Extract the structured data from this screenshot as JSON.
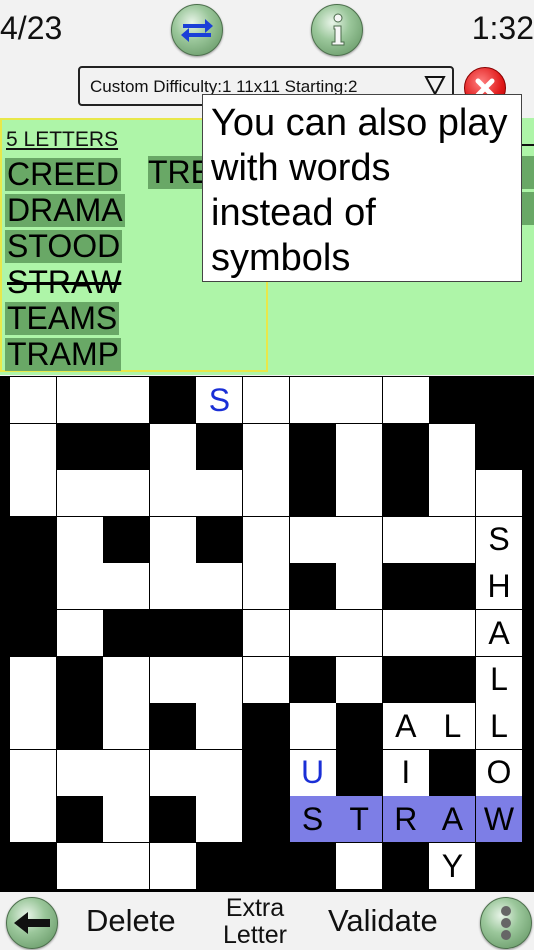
{
  "header": {
    "counter": "4/23",
    "timer": "1:32",
    "settings": "Custom  Difficulty:1  11x11  Starting:2"
  },
  "word_list": {
    "header": "5 LETTERS",
    "words": [
      {
        "text": "CREED",
        "found": false
      },
      {
        "text": "DRAMA",
        "found": false
      },
      {
        "text": "STOOD",
        "found": false
      },
      {
        "text": "STRAW",
        "found": true
      },
      {
        "text": "TEAMS",
        "found": false
      },
      {
        "text": "TRAMP",
        "found": false
      }
    ],
    "column2_fragment": "TRE"
  },
  "tooltip": {
    "text": "You can also play with words instead of symbols"
  },
  "grid": {
    "size": 11,
    "rows": [
      "___#S____##",
      "_##_#_#_#_#",
      "______#_#__",
      "#_#_#_____S",
      "#_____#_##H",
      "#_###_____A",
      "_#____#_##L",
      "_#_#_#_#ALL",
      "_____##U#I#O",
      "_#_#_#STRAW",
      "#___###_#Y#"
    ],
    "highlight": {
      "row": 9,
      "cols": [
        6,
        7,
        8,
        9,
        10
      ]
    },
    "blue_letters": [
      [
        0,
        4
      ],
      [
        8,
        6
      ]
    ]
  },
  "toolbar": {
    "delete": "Delete",
    "extra_line1": "Extra",
    "extra_line2": "Letter",
    "validate": "Validate"
  },
  "colors": {
    "panel_bg": "#aef5a8",
    "word_bg": "#69a866",
    "highlight": "#7d7ee6",
    "blue_letter": "#1a2fd6"
  }
}
